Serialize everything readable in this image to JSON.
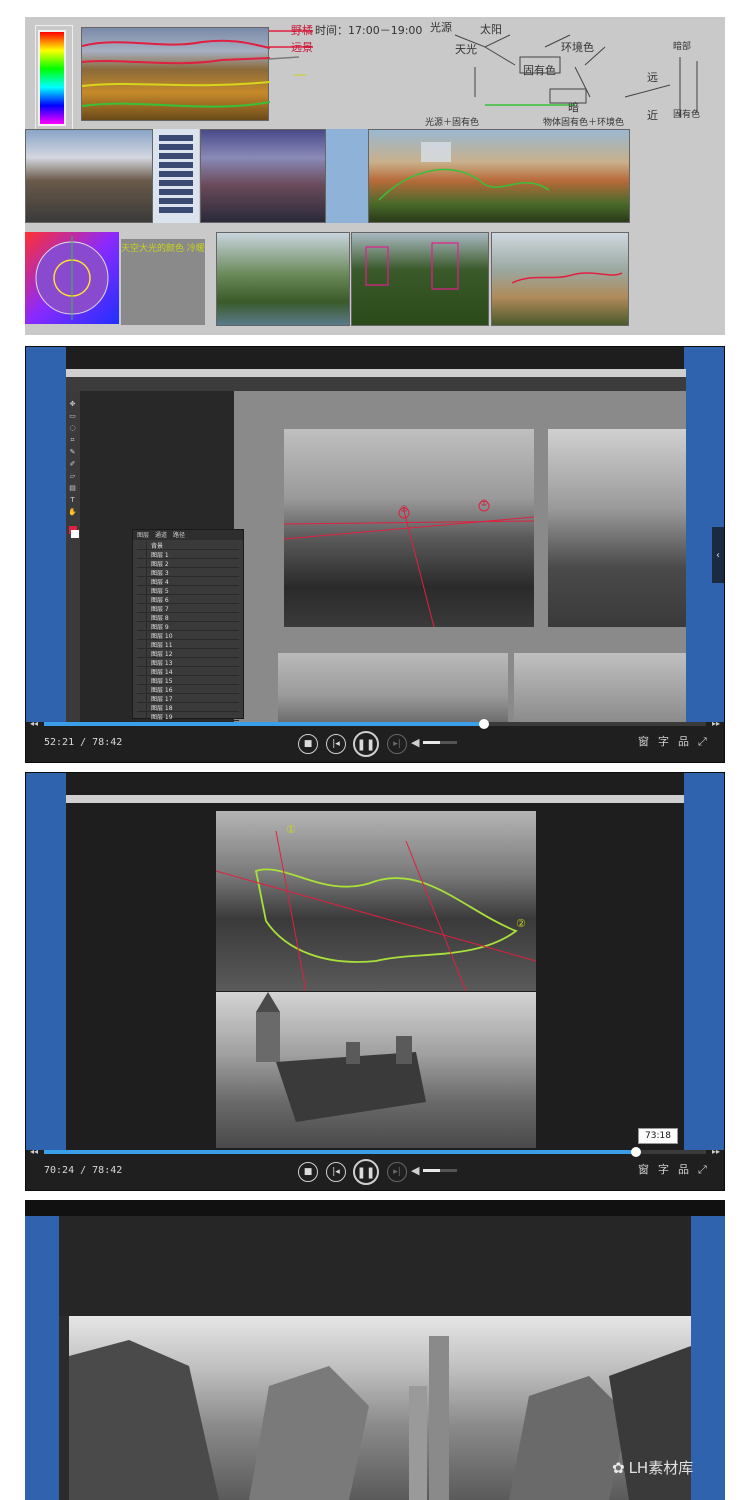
{
  "panel1": {
    "annotation_top_right_1": "野橘",
    "annotation_top_right_2": "远景",
    "time_label": "时间：17:00－19:00",
    "colorwheel_note": "天空大光的颜色 冷暖",
    "diagram": {
      "nodes": [
        "光源",
        "太阳",
        "天光",
        "环境色",
        "固有色",
        "暗",
        "光源＋固有色",
        "物体固有色＋环境色",
        "远",
        "近",
        "暗部",
        "固有色"
      ]
    }
  },
  "video1": {
    "time": "52:21 / 78:42",
    "progress": 0.664,
    "volume": 0.5,
    "layers_panel": {
      "tabs": [
        "图层",
        "通道",
        "路径"
      ],
      "rows": [
        "背景",
        "图层 1",
        "图层 2",
        "图层 3",
        "图层 4",
        "图层 5",
        "图层 6",
        "图层 7",
        "图层 8",
        "图层 9",
        "图层 10",
        "图层 11",
        "图层 12",
        "图层 13",
        "图层 14",
        "图层 15",
        "图层 16",
        "图层 17",
        "图层 18",
        "图层 19"
      ]
    },
    "annotation_1": "①",
    "annotation_2": "②",
    "right_controls": [
      "窗",
      "字",
      "品",
      "⤢"
    ]
  },
  "video2": {
    "time": "70:24 / 78:42",
    "progress": 0.894,
    "volume": 0.5,
    "hover_tooltip": "73:18",
    "annotation_1": "①",
    "annotation_2": "②",
    "right_controls": [
      "窗",
      "字",
      "品",
      "⤢"
    ]
  },
  "video3": {},
  "watermark": {
    "text": "LH素材库",
    "icon": "wechat-icon"
  },
  "colors": {
    "player_bg": "#1f1f1f",
    "progress": "#3b9ee8",
    "side_blue": "#2f63ad"
  }
}
